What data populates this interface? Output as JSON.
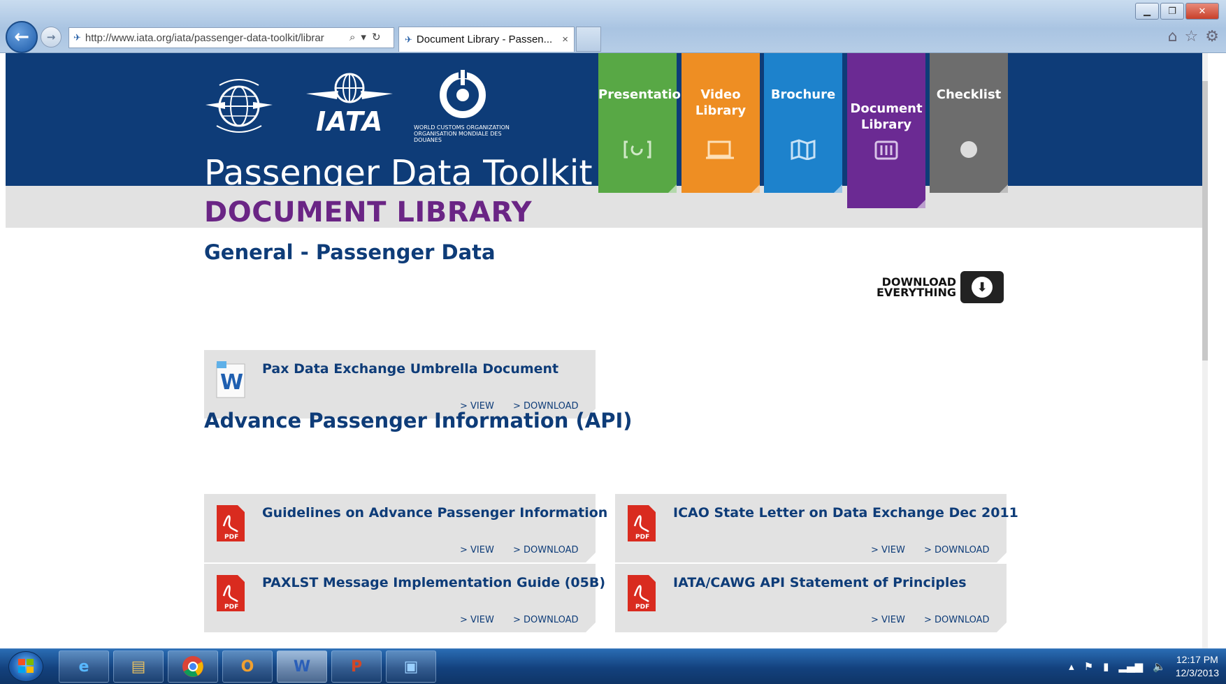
{
  "browser": {
    "url": "http://www.iata.org/iata/passenger-data-toolkit/librar",
    "tab_title": "Document Library - Passen...",
    "tab_close": "×"
  },
  "header": {
    "iata_logo_text": "IATA",
    "wco_logo_text": "WORLD CUSTOMS ORGANIZATION ORGANISATION MONDIALE DES DOUANES",
    "site_title": "Passenger Data Toolkit",
    "page_heading": "DOCUMENT LIBRARY"
  },
  "nav_tabs": [
    {
      "label": "Presentation",
      "color": "#58a845",
      "icon": "presentation-icon"
    },
    {
      "label": "Video Library",
      "color": "#ee8e23",
      "icon": "video-icon"
    },
    {
      "label": "Brochure",
      "color": "#1d82cc",
      "icon": "brochure-icon"
    },
    {
      "label": "Document Library",
      "color": "#6b2a93",
      "icon": "library-icon",
      "active": true
    },
    {
      "label": "Checklist",
      "color": "#6d6d6d",
      "icon": "checklist-icon"
    }
  ],
  "sections": [
    {
      "title": "General - Passenger Data"
    },
    {
      "title": "Advance Passenger Information (API)"
    }
  ],
  "download_everything": "DOWNLOAD EVERYTHING",
  "documents": [
    {
      "title": "Pax Data Exchange Umbrella Document",
      "type": "word",
      "view": "> VIEW",
      "download": "> DOWNLOAD"
    },
    {
      "title": "Guidelines on Advance Passenger Information",
      "type": "pdf",
      "view": "> VIEW",
      "download": "> DOWNLOAD"
    },
    {
      "title": "ICAO State Letter on Data Exchange Dec 2011",
      "type": "pdf",
      "view": "> VIEW",
      "download": "> DOWNLOAD"
    },
    {
      "title": "PAXLST Message Implementation Guide (05B)",
      "type": "pdf",
      "view": "> VIEW",
      "download": "> DOWNLOAD"
    },
    {
      "title": "IATA/CAWG API Statement of Principles",
      "type": "pdf",
      "view": "> VIEW",
      "download": "> DOWNLOAD"
    }
  ],
  "pdf_label": "PDF",
  "taskbar": {
    "apps": [
      "internet-explorer",
      "file-explorer",
      "chrome",
      "outlook",
      "word",
      "powerpoint",
      "remote-desktop"
    ],
    "time": "12:17 PM",
    "date": "12/3/2013"
  }
}
